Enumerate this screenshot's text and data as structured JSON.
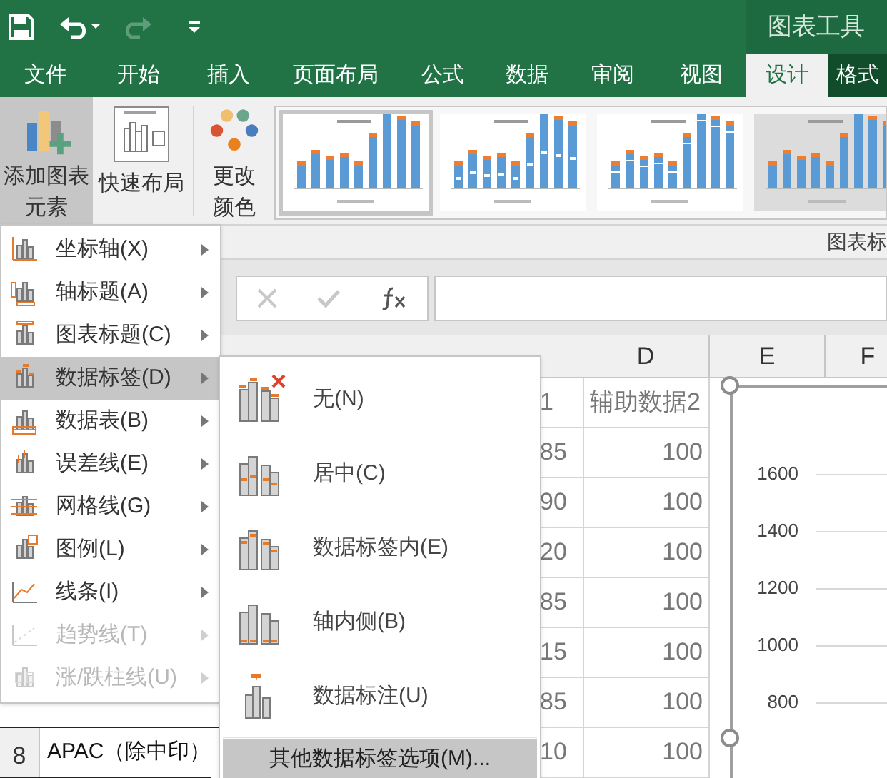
{
  "title_bar": {
    "context_title": "图表工具",
    "redo_disabled": true
  },
  "tabs": [
    {
      "label": "文件",
      "selected": false,
      "contextual": false
    },
    {
      "label": "开始",
      "selected": false,
      "contextual": false
    },
    {
      "label": "插入",
      "selected": false,
      "contextual": false
    },
    {
      "label": "页面布局",
      "selected": false,
      "contextual": false
    },
    {
      "label": "公式",
      "selected": false,
      "contextual": false
    },
    {
      "label": "数据",
      "selected": false,
      "contextual": false
    },
    {
      "label": "审阅",
      "selected": false,
      "contextual": false
    },
    {
      "label": "视图",
      "selected": false,
      "contextual": false
    },
    {
      "label": "设计",
      "selected": true,
      "contextual": true
    },
    {
      "label": "格式",
      "selected": false,
      "contextual": true
    }
  ],
  "ribbon": {
    "buttons": [
      {
        "kind": "add-element",
        "lines": [
          "添加图表",
          "元素"
        ],
        "pressed": true
      },
      {
        "kind": "layout",
        "lines": [
          "快速布局"
        ],
        "pressed": false
      },
      {
        "kind": "colors",
        "lines": [
          "更改",
          "颜色"
        ],
        "pressed": false
      }
    ],
    "styles": [
      {
        "kind": "plain",
        "selected": true
      },
      {
        "kind": "labels",
        "selected": false
      },
      {
        "kind": "striped",
        "selected": false
      },
      {
        "kind": "shaded",
        "selected": false
      }
    ],
    "group_label": "图表标"
  },
  "sheet": {
    "columns": [
      {
        "label": "D"
      },
      {
        "label": "E"
      },
      {
        "label": "F"
      }
    ],
    "column_c": [
      "1",
      "85",
      "90",
      "20",
      "85",
      "15",
      "85",
      "10"
    ],
    "column_d": [
      "辅助数据2",
      "100",
      "100",
      "100",
      "100",
      "100",
      "100",
      "100"
    ],
    "rows": [
      {
        "number": "8",
        "cell": "APAC（除中印）"
      }
    ],
    "chart_axis": [
      "1600",
      "1400",
      "1200",
      "1000",
      "800"
    ]
  },
  "menu": {
    "items": [
      {
        "label": "坐标轴(X)",
        "selected": false,
        "disabled": false
      },
      {
        "label": "轴标题(A)",
        "selected": false,
        "disabled": false
      },
      {
        "label": "图表标题(C)",
        "selected": false,
        "disabled": false
      },
      {
        "label": "数据标签(D)",
        "selected": true,
        "disabled": false
      },
      {
        "label": "数据表(B)",
        "selected": false,
        "disabled": false
      },
      {
        "label": "误差线(E)",
        "selected": false,
        "disabled": false
      },
      {
        "label": "网格线(G)",
        "selected": false,
        "disabled": false
      },
      {
        "label": "图例(L)",
        "selected": false,
        "disabled": false
      },
      {
        "label": "线条(I)",
        "selected": false,
        "disabled": false
      },
      {
        "label": "趋势线(T)",
        "selected": false,
        "disabled": true
      },
      {
        "label": "涨/跌柱线(U)",
        "selected": false,
        "disabled": true
      }
    ]
  },
  "submenu": {
    "items": [
      {
        "label": "无(N)",
        "kind": "none"
      },
      {
        "label": "居中(C)",
        "kind": "center"
      },
      {
        "label": "数据标签内(E)",
        "kind": "inside-end"
      },
      {
        "label": "轴内侧(B)",
        "kind": "inside-base"
      },
      {
        "label": "数据标注(U)",
        "kind": "callout"
      }
    ],
    "more": "其他数据标签选项(M)..."
  }
}
